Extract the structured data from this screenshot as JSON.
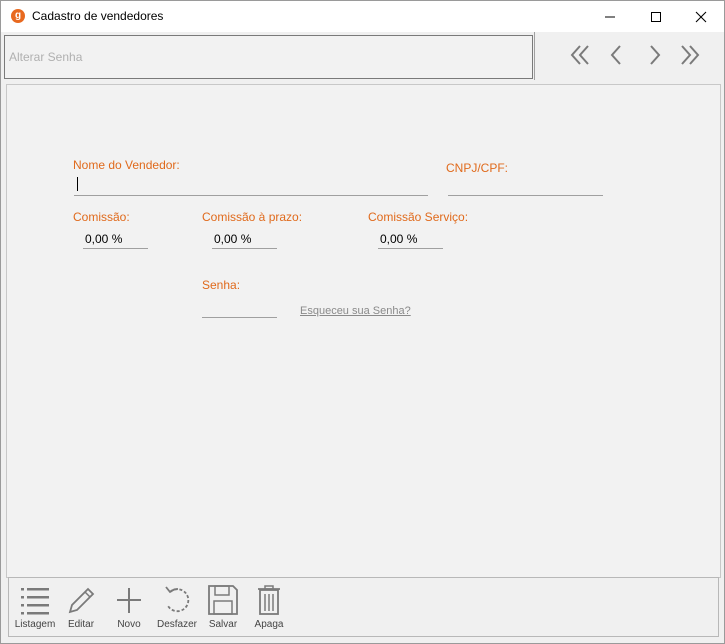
{
  "window": {
    "title": "Cadastro de vendedores",
    "app_icon_letter": "g"
  },
  "status_bar": {
    "text": "Alterar Senha"
  },
  "nav": {
    "first": "first-record-icon",
    "prev": "previous-record-icon",
    "next": "next-record-icon",
    "last": "last-record-icon"
  },
  "form": {
    "nome_label": "Nome do Vendedor:",
    "nome_value": "",
    "cnpj_label": "CNPJ/CPF:",
    "cnpj_value": "",
    "comissao_label": "Comissão:",
    "comissao_value": "0,00 %",
    "comissao_prazo_label": "Comissão à prazo:",
    "comissao_prazo_value": "0,00 %",
    "comissao_servico_label": "Comissão Serviço:",
    "comissao_servico_value": "0,00 %",
    "senha_label": "Senha:",
    "senha_value": "",
    "esqueceu_link": "Esqueceu sua Senha?"
  },
  "toolbar": {
    "listagem": "Listagem",
    "editar": "Editar",
    "novo": "Novo",
    "desfazer": "Desfazer",
    "salvar": "Salvar",
    "apaga": "Apaga"
  },
  "colors": {
    "accent": "#e06a1c",
    "icon": "#7a7a7a"
  }
}
